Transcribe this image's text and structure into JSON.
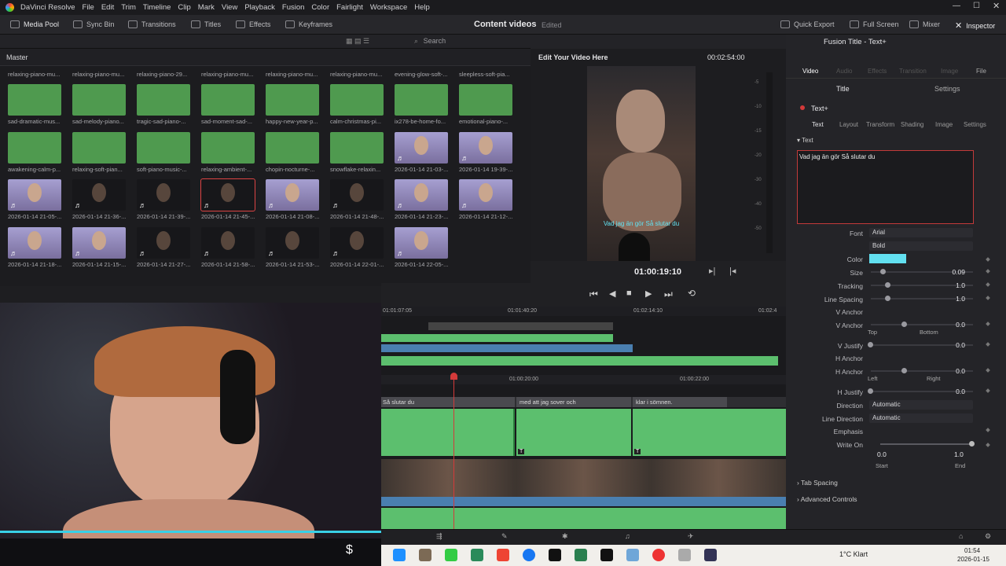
{
  "app": {
    "name": "DaVinci Resolve",
    "menu": [
      "File",
      "Edit",
      "Trim",
      "Timeline",
      "Clip",
      "Mark",
      "View",
      "Playback",
      "Fusion",
      "Color",
      "Fairlight",
      "Workspace",
      "Help"
    ]
  },
  "toolbar": {
    "media_pool": "Media Pool",
    "sync_bin": "Sync Bin",
    "transitions": "Transitions",
    "titles": "Titles",
    "effects": "Effects",
    "keyframes": "Keyframes",
    "project_title": "Content videos",
    "project_status": "Edited",
    "quick_export": "Quick Export",
    "full_screen": "Full Screen",
    "mixer": "Mixer",
    "inspector": "Inspector"
  },
  "media_pool": {
    "search_placeholder": "Search",
    "bin_name": "Master",
    "row0": [
      "relaxing-piano-mu...",
      "relaxing-piano-mu...",
      "relaxing-piano-29...",
      "relaxing-piano-mu...",
      "relaxing-piano-mu...",
      "relaxing-piano-mu...",
      "evening-glow-soft-...",
      "sleepless-soft-pia..."
    ],
    "row1": [
      "sad-dramatic-mus...",
      "sad-melody-piano...",
      "tragic-sad-piano-...",
      "sad-moment-sad-...",
      "happy-new-year-p...",
      "calm-christmas-pi...",
      "ix278-be-home-fo...",
      "emotional-piano-..."
    ],
    "row2": [
      "awakening-calm-p...",
      "relaxing-soft-pian...",
      "soft-piano-music-...",
      "relaxing-ambient-...",
      "chopin-nocturne-...",
      "snowflake-relaxin...",
      "2026-01-14 21-03-...",
      "2026-01-14 19-39-..."
    ],
    "row3": [
      "2026-01-14 21-05-...",
      "2026-01-14 21-36-...",
      "2026-01-14 21-39-...",
      "2026-01-14 21-45-...",
      "2026-01-14 21-08-...",
      "2026-01-14 21-48-...",
      "2026-01-14 21-23-...",
      "2026-01-14 21-12-..."
    ],
    "row4": [
      "2026-01-14 21-18-...",
      "2026-01-14 21-15-...",
      "2026-01-14 21-27-...",
      "2026-01-14 21-58-...",
      "2026-01-14 21-53-...",
      "2026-01-14 22-01-...",
      "2026-01-14 22-05-..."
    ]
  },
  "viewer": {
    "timeline_name": "Edit Your Video Here",
    "duration": "00:02:54:00",
    "timecode": "01:00:19:10",
    "subtitle": "Vad jag än gör Så slutar du",
    "meter_ticks": [
      "-5",
      "-10",
      "-15",
      "-20",
      "-30",
      "-40",
      "-50"
    ]
  },
  "timeline": {
    "ruler_top": [
      "01:01:07:05",
      "01:01:40:20",
      "01:02:14:10",
      "01:02:4"
    ],
    "ruler": [
      "01:00:20:00",
      "01:00:22:00"
    ],
    "subtitles": [
      "Så slutar du",
      "med att jag sover och",
      "klar i sömnen."
    ]
  },
  "inspector": {
    "title": "Fusion Title - Text+",
    "tabs": [
      "Video",
      "Audio",
      "Effects",
      "Transition",
      "Image",
      "File"
    ],
    "sub_tabs": [
      "Title",
      "Settings"
    ],
    "node": "Text+",
    "node_tabs": [
      "Text",
      "Layout",
      "Transform",
      "Shading",
      "Image",
      "Settings"
    ],
    "section": "Text",
    "text_value": "Vad jag än gör Så slutar du",
    "font_label": "Font",
    "font": "Arial",
    "style": "Bold",
    "color_label": "Color",
    "color_value": "#62e0f0",
    "size_label": "Size",
    "size": "0.09",
    "tracking_label": "Tracking",
    "tracking": "1.0",
    "line_spacing_label": "Line Spacing",
    "line_spacing": "1.0",
    "v_anchor_label": "V Anchor",
    "v_anchor": "0.0",
    "top": "Top",
    "bottom": "Bottom",
    "v_justify_label": "V Justify",
    "v_justify": "0.0",
    "h_anchor_label": "H Anchor",
    "h_anchor": "0.0",
    "left": "Left",
    "right": "Right",
    "h_justify_label": "H Justify",
    "h_justify": "0.0",
    "direction_label": "Direction",
    "direction": "Automatic",
    "line_direction_label": "Line Direction",
    "line_direction": "Automatic",
    "emphasis_label": "Emphasis",
    "write_on_label": "Write On",
    "write_on_start": "0.0",
    "write_on_end": "1.0",
    "start": "Start",
    "end": "End",
    "tab_spacing": "Tab Spacing",
    "advanced": "Advanced Controls"
  },
  "taskbar": {
    "weather": "1°C  Klart",
    "time": "01:54",
    "date": "2026-01-15"
  },
  "colors": {
    "accent": "#d43a3a",
    "audio_green": "#5cbf6e",
    "video_blue": "#4a7fb0",
    "text_cyan": "#62e0f0"
  }
}
